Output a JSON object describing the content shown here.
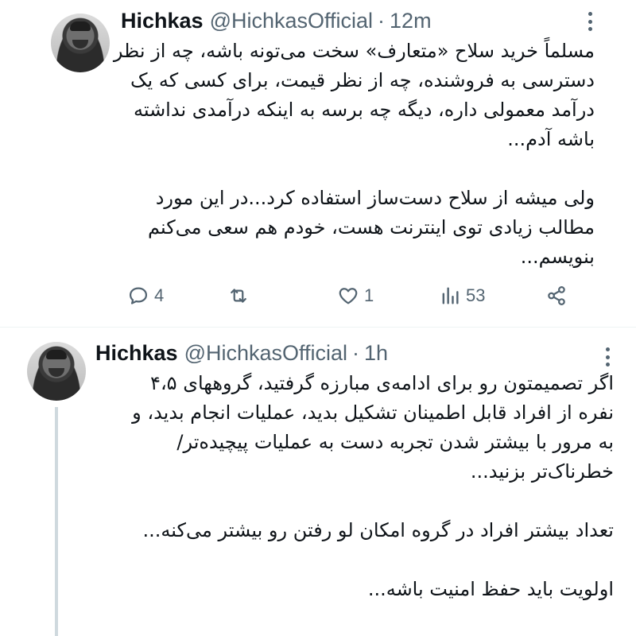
{
  "tweets": [
    {
      "author": {
        "name": "Hichkas",
        "handle": "@HichkasOfficial"
      },
      "separator": "·",
      "time": "12m",
      "paragraphs": [
        [
          "مسلماً خرید سلاح «متعارف» سخت می‌تونه باشه، چه از نظر",
          "دسترسی به فروشنده، چه از نظر قیمت، برای کسی که یک",
          "درآمد معمولی داره، دیگه چه برسه به اینکه درآمدی نداشته",
          "باشه آدم..."
        ],
        [
          "ولی میشه از سلاح دست‌ساز استفاده کرد...در این مورد",
          "مطالب زیادی توی اینترنت هست، خودم هم سعی می‌کنم",
          "بنویسم..."
        ]
      ],
      "actions": {
        "reply_icon": "comment-icon",
        "reply_count": "4",
        "retweet_icon": "retweet-icon",
        "retweet_count": "",
        "like_icon": "heart-icon",
        "like_count": "1",
        "views_icon": "analytics-icon",
        "views_count": "53",
        "share_icon": "share-icon"
      }
    },
    {
      "author": {
        "name": "Hichkas",
        "handle": "@HichkasOfficial"
      },
      "separator": "·",
      "time": "1h",
      "paragraphs": [
        [
          "اگر تصمیمتون رو برای ادامه‌ی مبارزه گرفتید، گروههای ۴،۵",
          "نفره از افراد قابل اطمینان تشکیل بدید، عملیات انجام بدید، و",
          "به مرور با بیشتر شدن تجربه دست به عملیات پیچیده‌تر/",
          "خطرناک‌تر بزنید..."
        ],
        [
          "تعداد بیشتر افراد در گروه امکان لو رفتن رو بیشتر می‌کنه..."
        ],
        [
          "اولویت باید حفظ امنیت باشه..."
        ]
      ]
    }
  ],
  "colors": {
    "text": "#0f1419",
    "secondary": "#536471",
    "thread_line": "#cfd9de"
  }
}
